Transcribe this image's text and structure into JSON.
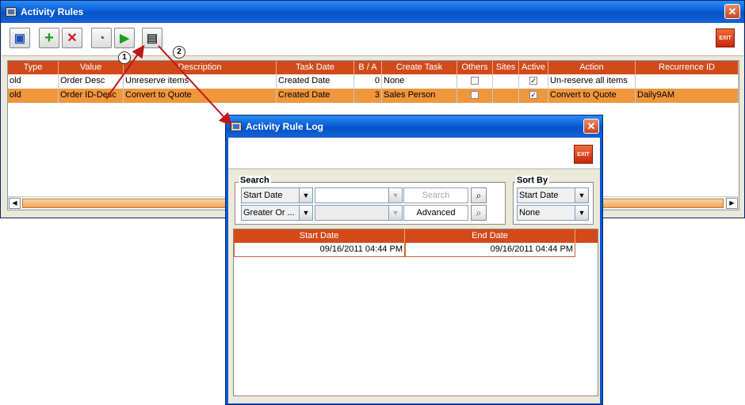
{
  "main_window": {
    "title": "Activity Rules",
    "close_glyph": "✕",
    "exit_label": "EXIT",
    "toolbar_icons": [
      "save-icon",
      "add-icon",
      "delete-icon",
      "log-viewer-icon",
      "run-icon",
      "log-icon"
    ],
    "table": {
      "columns": [
        "Type",
        "Value",
        "Description",
        "Task Date",
        "B / A",
        "Create Task",
        "Others",
        "Sites",
        "Active",
        "Action",
        "Recurrence ID"
      ],
      "rows": [
        {
          "type": "old",
          "value": "Order Desc",
          "description": "Unreserve items",
          "task_date": "Created Date",
          "ba": "0",
          "create_task": "None",
          "others": "",
          "sites": "",
          "active": "✓",
          "action": "Un-reserve all items",
          "recurrence_id": "",
          "selected": false
        },
        {
          "type": "old",
          "value": "Order ID-Desc",
          "description": "Convert to Quote",
          "task_date": "Created Date",
          "ba": "3",
          "create_task": "Sales Person",
          "others": "",
          "sites": "",
          "active": "✓",
          "action": "Convert to Quote",
          "recurrence_id": "Daily9AM",
          "selected": true
        }
      ]
    }
  },
  "callouts": [
    "1",
    "2"
  ],
  "log_window": {
    "title": "Activity Rule Log",
    "close_glyph": "✕",
    "exit_label": "EXIT",
    "search": {
      "label": "Search",
      "field_combo": "Start Date",
      "operator_combo": "Greater Or ...",
      "value_input": "",
      "search_button": "Search",
      "advanced_button": "Advanced"
    },
    "sort": {
      "label": "Sort By",
      "primary": "Start Date",
      "secondary": "None"
    },
    "table": {
      "columns": [
        "Start Date",
        "End Date"
      ],
      "rows": [
        {
          "start_date": "09/16/2011 04:44 PM",
          "end_date": "09/16/2011 04:44 PM"
        }
      ]
    }
  },
  "colors": {
    "header_orange": "#d24a1a",
    "selected_row": "#f0963c",
    "title_blue": "#0553c6"
  }
}
